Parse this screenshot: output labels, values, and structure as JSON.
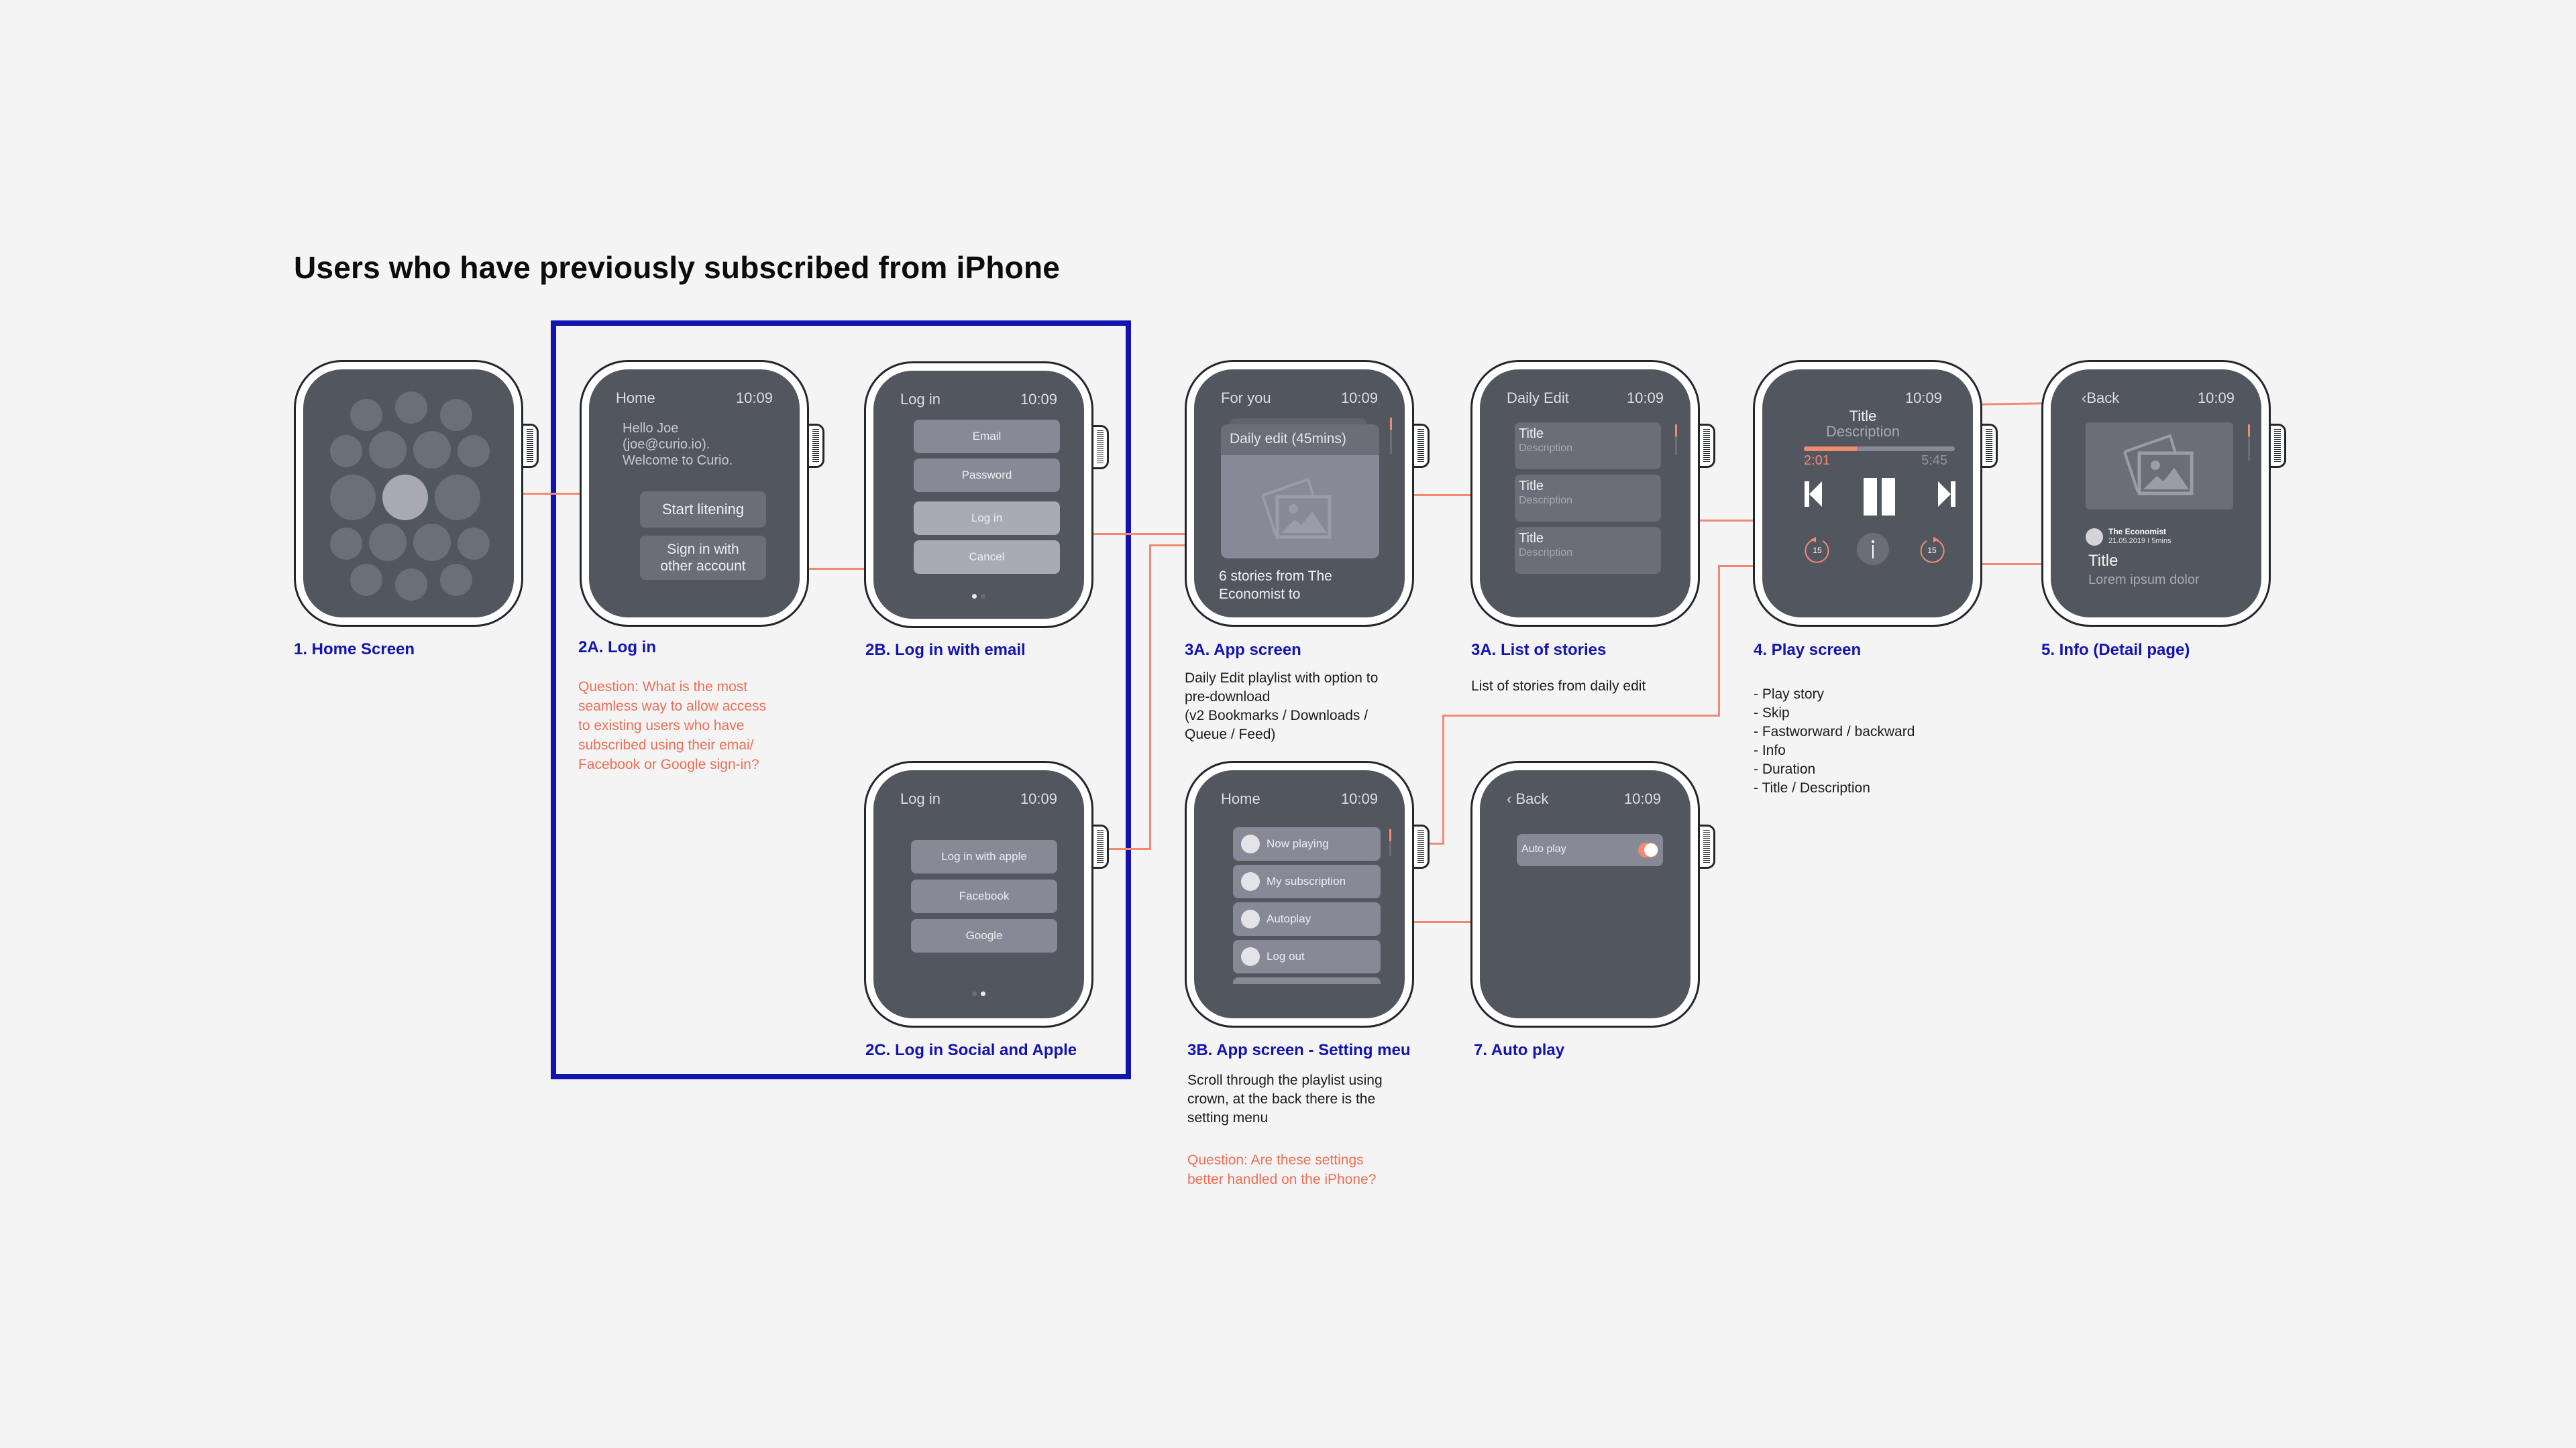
{
  "page_title": "Users who have previously subscribed from iPhone",
  "accent_colors": {
    "connector": "#f28a72",
    "label_blue": "#1313b3",
    "question_red": "#ef6e55",
    "screen": "#52565e"
  },
  "screens": {
    "home": {
      "label": "1. Home Screen",
      "selected_app_icon": "curio-app-icon"
    },
    "login": {
      "label": "2A. Log in",
      "header_left": "Home",
      "time": "10:09",
      "greeting_line1": "Hello Joe",
      "greeting_line2": "(joe@curio.io).",
      "greeting_line3": "Welcome to Curio.",
      "start_button": "Start litening",
      "other_account_line1": "Sign in with",
      "other_account_line2": "other account",
      "question": [
        "Question: What is the most",
        "seamless way to allow access",
        "to existing users who have",
        "subscribed using their emai/",
        "Facebook or Google sign-in?"
      ]
    },
    "login_email": {
      "label": "2B. Log in with email",
      "header_left": "Log in",
      "time": "10:09",
      "email": "Email",
      "password": "Password",
      "login": "Log in",
      "cancel": "Cancel",
      "page": "1 of 2"
    },
    "login_social": {
      "label": "2C. Log in Social and Apple",
      "header_left": "Log in",
      "time": "10:09",
      "apple": "Log in with apple",
      "facebook": "Facebook",
      "google": "Google",
      "page": "2 of 2"
    },
    "app": {
      "label": "3A. App screen",
      "header_left": "For you",
      "time": "10:09",
      "card_title": "Daily edit (45mins)",
      "card_image": "image-placeholder-icon",
      "caption_line1": "6 stories from The",
      "caption_line2": "Economist to",
      "desc": [
        "Daily Edit playlist with option to",
        "pre-download",
        "(v2 Bookmarks / Downloads /",
        "Queue / Feed)"
      ]
    },
    "stories": {
      "label": "3A. List of stories",
      "header_left": "Daily Edit",
      "time": "10:09",
      "items": [
        {
          "title": "Title",
          "description": "Description"
        },
        {
          "title": "Title",
          "description": "Description"
        },
        {
          "title": "Title",
          "description": "Description"
        }
      ],
      "desc": "List of stories from daily edit"
    },
    "play": {
      "label": "4. Play screen",
      "time": "10:09",
      "title": "Title",
      "description": "Description",
      "elapsed": "2:01",
      "total": "5:45",
      "progress_fraction": 0.35,
      "skip_seconds": "15",
      "features": [
        "- Play story",
        "- Skip",
        "- Fastworward / backward",
        "- Info",
        "- Duration",
        "- Title / Description"
      ]
    },
    "info": {
      "label": "5. Info (Detail page)",
      "back": "Back",
      "time": "10:09",
      "source": "The Economist",
      "meta": "21.05.2019 I 5mins",
      "title": "Title",
      "body": "Lorem ipsum dolor"
    },
    "settings": {
      "label": "3B. App screen - Setting meu",
      "header_left": "Home",
      "time": "10:09",
      "items": [
        "Now playing",
        "My subscription",
        "Autoplay",
        "Log out"
      ],
      "desc": [
        "Scroll through the playlist using",
        "crown, at the back there is the",
        "setting menu"
      ],
      "question": [
        "Question: Are these settings",
        "better handled on the iPhone?"
      ]
    },
    "autoplay": {
      "label": "7. Auto play",
      "back": "Back",
      "time": "10:09",
      "toggle_label": "Auto play",
      "toggle_on": true
    }
  }
}
